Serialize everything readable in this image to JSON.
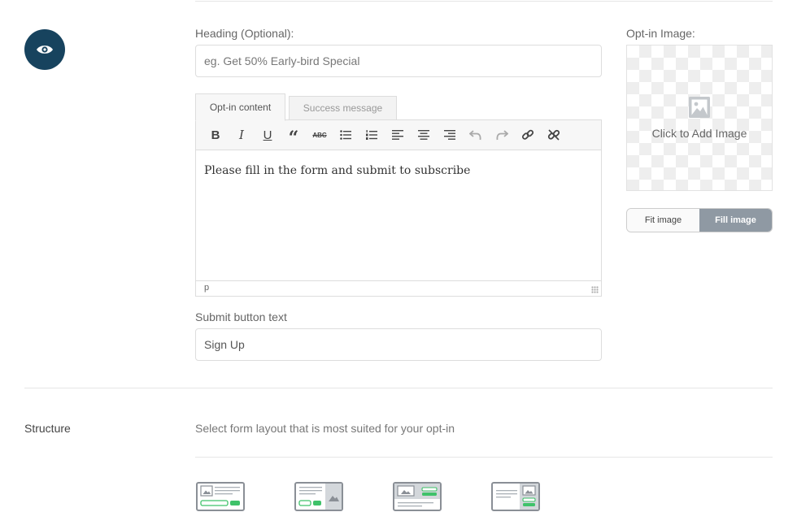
{
  "content": {
    "heading_label": "Heading (Optional):",
    "heading_placeholder": "eg. Get 50% Early-bird Special",
    "tabs": [
      {
        "label": "Opt-in content"
      },
      {
        "label": "Success message"
      }
    ],
    "editor_text": "Please fill in the form and submit to subscribe",
    "editor_status": "p",
    "submit_label": "Submit button text",
    "submit_value": "Sign Up"
  },
  "image": {
    "label": "Opt-in Image:",
    "placeholder_text": "Click to Add Image",
    "fit_option": "Fit image",
    "fill_option": "Fill image",
    "selected": "Fill image"
  },
  "structure": {
    "label": "Structure",
    "description": "Select form layout that is most suited for your opt-in"
  },
  "colors": {
    "accent": "#17435e",
    "green": "#3fc26a",
    "toggle_active": "#8f99a3"
  }
}
